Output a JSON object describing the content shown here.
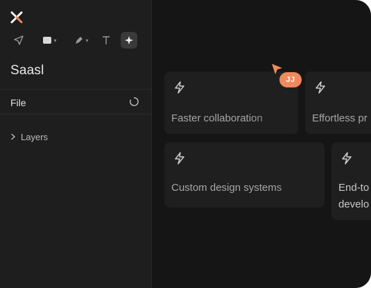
{
  "app": {
    "project_name": "Saasl"
  },
  "toolbar": {
    "tools": [
      "move-tool",
      "frame-tool",
      "pen-tool",
      "text-tool",
      "ai-tool"
    ]
  },
  "panels": {
    "file_label": "File",
    "layers_label": "Layers"
  },
  "cards": [
    {
      "title": "Faster collaboration"
    },
    {
      "title": "Effortless pr"
    },
    {
      "title": "Custom design systems"
    },
    {
      "title_line1": "End-to",
      "title_line2": "develo"
    }
  ],
  "collaborator": {
    "initials": "JJ",
    "color": "#f08a5d"
  },
  "colors": {
    "background": "#151515",
    "sidebar": "#1e1e1e",
    "card": "#1f1f1f",
    "accent": "#f08a5d"
  }
}
